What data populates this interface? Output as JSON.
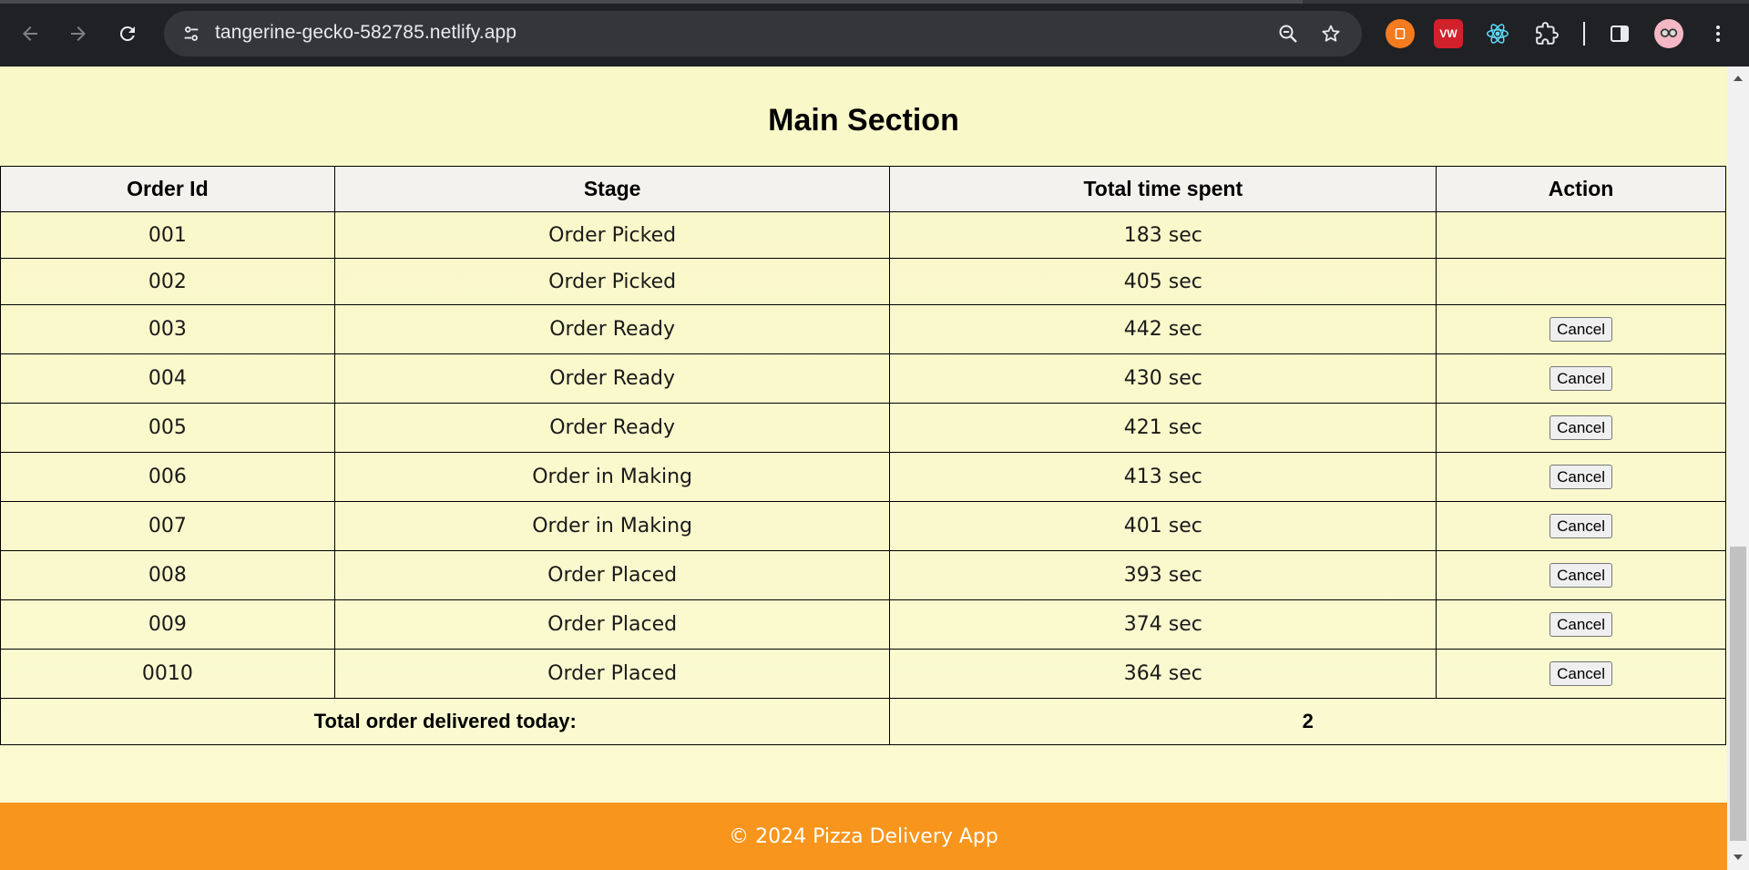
{
  "browser": {
    "url": "tangerine-gecko-582785.netlify.app",
    "extensions": [
      {
        "name": "extension-orange-icon",
        "label": "",
        "color": "#f47b20"
      },
      {
        "name": "extension-vw-icon",
        "label": "VW",
        "color": "#d3202a"
      },
      {
        "name": "react-devtools-icon",
        "label": "",
        "color": "#61dafb"
      }
    ]
  },
  "main": {
    "title": "Main Section",
    "columns": [
      "Order Id",
      "Stage",
      "Total time spent",
      "Action"
    ],
    "rows": [
      {
        "id": "001",
        "stage": "Order Picked",
        "time": "183 sec",
        "action": ""
      },
      {
        "id": "002",
        "stage": "Order Picked",
        "time": "405 sec",
        "action": ""
      },
      {
        "id": "003",
        "stage": "Order Ready",
        "time": "442 sec",
        "action": "Cancel"
      },
      {
        "id": "004",
        "stage": "Order Ready",
        "time": "430 sec",
        "action": "Cancel"
      },
      {
        "id": "005",
        "stage": "Order Ready",
        "time": "421 sec",
        "action": "Cancel"
      },
      {
        "id": "006",
        "stage": "Order in Making",
        "time": "413 sec",
        "action": "Cancel"
      },
      {
        "id": "007",
        "stage": "Order in Making",
        "time": "401 sec",
        "action": "Cancel"
      },
      {
        "id": "008",
        "stage": "Order Placed",
        "time": "393 sec",
        "action": "Cancel"
      },
      {
        "id": "009",
        "stage": "Order Placed",
        "time": "374 sec",
        "action": "Cancel"
      },
      {
        "id": "0010",
        "stage": "Order Placed",
        "time": "364 sec",
        "action": "Cancel"
      }
    ],
    "total_label": "Total order delivered today:",
    "total_value": "2"
  },
  "footer": {
    "text": "© 2024 Pizza Delivery App"
  },
  "colors": {
    "page_background": "#fbfad0",
    "footer": "#f8951d",
    "header_row": "#f3f2ee"
  }
}
